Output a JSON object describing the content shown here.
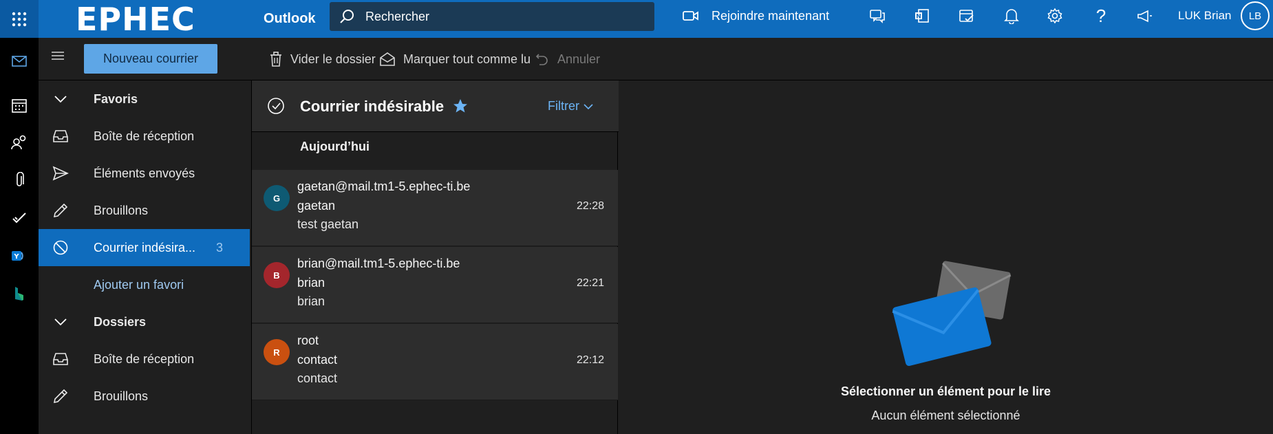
{
  "header": {
    "logo_text": "EPHEC",
    "app_name": "Outlook",
    "search_placeholder": "Rechercher",
    "join_label": "Rejoindre maintenant",
    "user_name": "LUK Brian",
    "user_initials": "LB",
    "brand_color": "#0f6cbd"
  },
  "commands": {
    "new_mail": "Nouveau courrier",
    "empty_folder": "Vider le dossier",
    "mark_all_read": "Marquer tout comme lu",
    "undo": "Annuler"
  },
  "folders": {
    "favorites_header": "Favoris",
    "favorites": [
      {
        "label": "Boîte de réception",
        "icon": "inbox-icon"
      },
      {
        "label": "Éléments envoyés",
        "icon": "send-icon"
      },
      {
        "label": "Brouillons",
        "icon": "pencil-icon"
      },
      {
        "label": "Courrier indésira...",
        "icon": "blocked-icon",
        "count": "3",
        "selected": true
      }
    ],
    "add_favorite": "Ajouter un favori",
    "folders_header": "Dossiers",
    "folders": [
      {
        "label": "Boîte de réception",
        "icon": "inbox-icon"
      },
      {
        "label": "Brouillons",
        "icon": "pencil-icon"
      }
    ]
  },
  "message_list": {
    "title": "Courrier indésirable",
    "filter_label": "Filtrer",
    "group_label": "Aujourd’hui",
    "messages": [
      {
        "initial": "G",
        "avatar_color": "#0e5a73",
        "from": "gaetan@mail.tm1-5.ephec-ti.be",
        "subject": "gaetan",
        "preview": "test gaetan",
        "time": "22:28"
      },
      {
        "initial": "B",
        "avatar_color": "#a4262c",
        "from": "brian@mail.tm1-5.ephec-ti.be",
        "subject": "brian",
        "preview": "brian",
        "time": "22:21"
      },
      {
        "initial": "R",
        "avatar_color": "#ca5010",
        "from": "root",
        "subject": "contact",
        "preview": "contact",
        "time": "22:12"
      }
    ]
  },
  "reading_pane": {
    "title": "Sélectionner un élément pour le lire",
    "subtitle": "Aucun élément sélectionné"
  }
}
